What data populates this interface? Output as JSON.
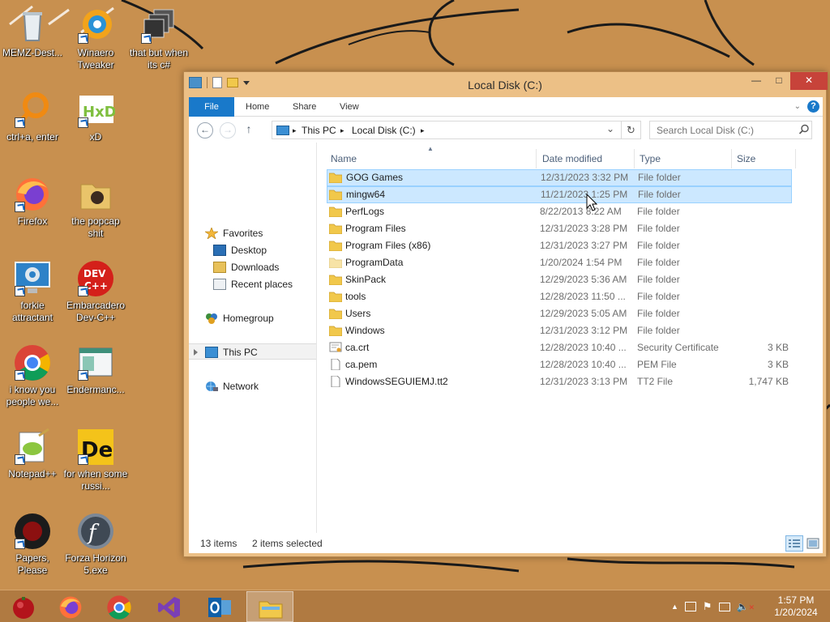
{
  "desktop": {
    "icons": [
      {
        "label": "MEMZ-Dest...",
        "icon": "recycle-bin-icon"
      },
      {
        "label": "Winaero Tweaker",
        "icon": "winaero-icon"
      },
      {
        "label": "that but when its c#",
        "icon": "stacked-windows-icon"
      },
      {
        "label": "ctrl+a, enter",
        "icon": "magnifier-icon"
      },
      {
        "label": "xD",
        "icon": "hxd-icon"
      },
      {
        "label": "Firefox",
        "icon": "firefox-icon"
      },
      {
        "label": "the popcap shit",
        "icon": "folder-icon"
      },
      {
        "label": "forkie attractant",
        "icon": "settings-monitor-icon"
      },
      {
        "label": "Embarcadero Dev-C++",
        "icon": "devcpp-icon"
      },
      {
        "label": "i know you people we...",
        "icon": "chrome-icon"
      },
      {
        "label": "Endermanc...",
        "icon": "window-app-icon"
      },
      {
        "label": "Notepad++",
        "icon": "notepadpp-icon"
      },
      {
        "label": "for when some russi...",
        "icon": "de-icon"
      },
      {
        "label": "Papers, Please",
        "icon": "papers-please-icon"
      },
      {
        "label": "Forza Horizon 5.exe",
        "icon": "flash-icon"
      }
    ]
  },
  "window": {
    "title": "Local Disk (C:)",
    "ribbon_tabs": [
      "File",
      "Home",
      "Share",
      "View"
    ],
    "help_label": "?",
    "address": {
      "crumbs": [
        "This PC",
        "Local Disk (C:)"
      ]
    },
    "search": {
      "placeholder": "Search Local Disk (C:)"
    },
    "nav": {
      "favorites": "Favorites",
      "desktop": "Desktop",
      "downloads": "Downloads",
      "recent": "Recent places",
      "homegroup": "Homegroup",
      "thispc": "This PC",
      "network": "Network"
    },
    "columns": {
      "name": "Name",
      "date": "Date modified",
      "type": "Type",
      "size": "Size"
    },
    "files": [
      {
        "name": "GOG Games",
        "date": "12/31/2023 3:32 PM",
        "type": "File folder",
        "size": "",
        "kind": "folder",
        "selected": true
      },
      {
        "name": "mingw64",
        "date": "11/21/2023 1:25 PM",
        "type": "File folder",
        "size": "",
        "kind": "folder",
        "selected": true
      },
      {
        "name": "PerfLogs",
        "date": "8/22/2013 8:22 AM",
        "type": "File folder",
        "size": "",
        "kind": "folder",
        "selected": false
      },
      {
        "name": "Program Files",
        "date": "12/31/2023 3:28 PM",
        "type": "File folder",
        "size": "",
        "kind": "folder",
        "selected": false
      },
      {
        "name": "Program Files (x86)",
        "date": "12/31/2023 3:27 PM",
        "type": "File folder",
        "size": "",
        "kind": "folder",
        "selected": false
      },
      {
        "name": "ProgramData",
        "date": "1/20/2024 1:54 PM",
        "type": "File folder",
        "size": "",
        "kind": "folder-hidden",
        "selected": false
      },
      {
        "name": "SkinPack",
        "date": "12/29/2023 5:36 AM",
        "type": "File folder",
        "size": "",
        "kind": "folder",
        "selected": false
      },
      {
        "name": "tools",
        "date": "12/28/2023 11:50 ...",
        "type": "File folder",
        "size": "",
        "kind": "folder",
        "selected": false
      },
      {
        "name": "Users",
        "date": "12/29/2023 5:05 AM",
        "type": "File folder",
        "size": "",
        "kind": "folder",
        "selected": false
      },
      {
        "name": "Windows",
        "date": "12/31/2023 3:12 PM",
        "type": "File folder",
        "size": "",
        "kind": "folder",
        "selected": false
      },
      {
        "name": "ca.crt",
        "date": "12/28/2023 10:40 ...",
        "type": "Security Certificate",
        "size": "3 KB",
        "kind": "certificate",
        "selected": false
      },
      {
        "name": "ca.pem",
        "date": "12/28/2023 10:40 ...",
        "type": "PEM File",
        "size": "3 KB",
        "kind": "file",
        "selected": false
      },
      {
        "name": "WindowsSEGUIEMJ.tt2",
        "date": "12/31/2023 3:13 PM",
        "type": "TT2 File",
        "size": "1,747 KB",
        "kind": "file",
        "selected": false
      }
    ],
    "status": {
      "count": "13 items",
      "selected": "2 items selected"
    }
  },
  "taskbar": {
    "apps": [
      "start-orb-icon",
      "firefox-icon",
      "chrome-icon",
      "visual-studio-icon",
      "outlook-icon",
      "file-explorer-icon"
    ],
    "active_app": "file-explorer-icon",
    "tray_icons": [
      "show-hidden-icon",
      "network-icon",
      "flag-icon",
      "printer-icon",
      "volume-muted-icon"
    ],
    "clock": {
      "time": "1:57 PM",
      "date": "1/20/2024"
    }
  },
  "colors": {
    "accent": "#1979ca",
    "selection": "#cce8ff",
    "selection_border": "#99d1ff",
    "desktop": "#c8904f",
    "window_frame": "#ecc086",
    "close": "#c7433a"
  }
}
